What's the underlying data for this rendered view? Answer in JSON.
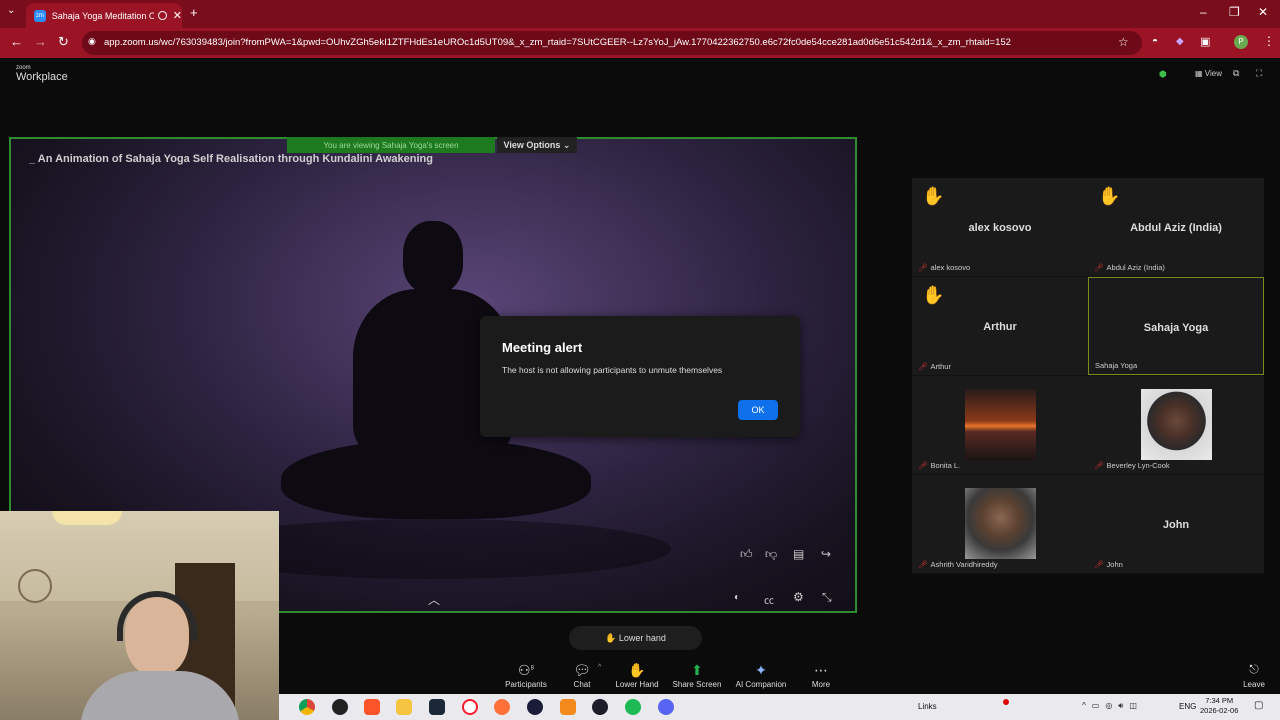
{
  "browser": {
    "tab_title": "Sahaja Yoga Meditation On",
    "tab_favicon": "zoom",
    "url_host": "app.zoom.us",
    "url_path": "/wc/763039483/join?fromPWA=1&pwd=OUhvZGh5ekI1ZTFHdEs1eUROc1d5UT09&_x_zm_rtaid=7SUtCGEER--Lz7sYoJ_jAw.1770422362750.e6c72fc0de54cce281ad0d6e51c542d1&_x_zm_rhtaid=152",
    "profile_initial": "P"
  },
  "zoom": {
    "logo_top": "zoom",
    "logo_bottom": "Workplace",
    "view_label": "View",
    "share_title": "_ An Animation of Sahaja Yoga Self Realisation through Kundalini Awakening",
    "viewing_banner": "You are viewing Sahaja Yoga's screen",
    "view_options": "View Options"
  },
  "alert": {
    "title": "Meeting alert",
    "message": "The host is not allowing participants to unmute themselves",
    "ok_label": "OK"
  },
  "participants": [
    {
      "big": "alex kosovo",
      "name": "alex kosovo",
      "hand": true
    },
    {
      "big": "Abdul Aziz (India)",
      "name": "Abdul Aziz (India)",
      "hand": true
    },
    {
      "big": "Arthur",
      "name": "Arthur",
      "hand": true
    },
    {
      "big": "Sahaja Yoga",
      "name": "Sahaja Yoga",
      "hand": false,
      "active": true
    },
    {
      "big": "",
      "name": "Bonita L.",
      "hand": false,
      "photo": "sunset"
    },
    {
      "big": "",
      "name": "Beverley Lyn-Cook",
      "hand": false,
      "photo": "woman"
    },
    {
      "big": "",
      "name": "Ashrith Varidhireddy",
      "hand": false,
      "photo": "man"
    },
    {
      "big": "John",
      "name": "John",
      "hand": false
    }
  ],
  "lower_hand_pill": "Lower hand",
  "toolbar": {
    "participants": "Participants",
    "participants_count": "8",
    "chat": "Chat",
    "lower_hand": "Lower Hand",
    "share_screen": "Share Screen",
    "ai_companion": "AI Companion",
    "more": "More",
    "leave": "Leave"
  },
  "taskbar": {
    "links": "Links",
    "lang": "ENG",
    "time": "7:34 PM",
    "date": "2026-02-06"
  },
  "colors": {
    "tab_bar": "#7a0d1c",
    "share_border": "#2e8b2e",
    "ok_button": "#0e71eb",
    "raise_hand": "#e8b400"
  }
}
